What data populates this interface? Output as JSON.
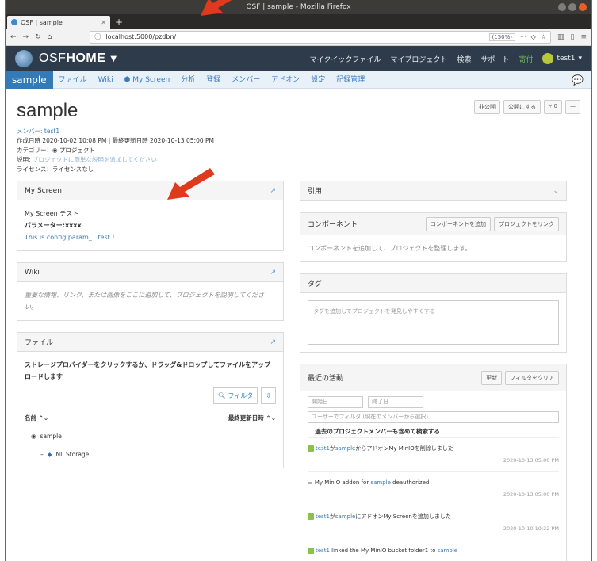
{
  "window": {
    "title": "OSF | sample - Mozilla Firefox"
  },
  "browser": {
    "tab_label": "OSF | sample",
    "url": "localhost:5000/pzdbn/",
    "zoom": "(150%)"
  },
  "osf": {
    "brand_light": "OSF",
    "brand_bold": "HOME",
    "menu": [
      "マイクイックファイル",
      "マイプロジェクト",
      "検索",
      "サポート",
      "寄付"
    ],
    "user": "test1"
  },
  "project_nav": {
    "items": [
      "sample",
      "ファイル",
      "Wiki",
      "My Screen",
      "分析",
      "登録",
      "メンバー",
      "アドオン",
      "設定",
      "記録管理"
    ]
  },
  "project": {
    "title": "sample",
    "members_label": "メンバー:",
    "members_value": "test1",
    "dates": "作成日時 2020-10-02 10:08 PM | 最終更新日時 2020-10-13 05:00 PM",
    "category": "カテゴリー：",
    "category_value": "プロジェクト",
    "description_label": "説明:",
    "description_value": "プロジェクトに簡単な説明を追加してください",
    "license": "ライセンス：ライセンスなし",
    "buttons": [
      "非公開",
      "公開にする",
      "0",
      "—"
    ]
  },
  "panels": {
    "myscreen": {
      "title": "My Screen",
      "line1": "My Screen テスト",
      "line2": "パラメーター:xxxx",
      "line3": "This is config.param_1 test !"
    },
    "wiki": {
      "title": "Wiki",
      "body": "重要な情報、リンク、または画像をここに追加して、プロジェクトを説明してください。"
    },
    "files": {
      "title": "ファイル",
      "intro": "ストレージプロバイダーをクリックするか、ドラッグ&ドロップしてファイルをアップロードします",
      "filter": "フィルタ",
      "col_name": "名前",
      "col_modified": "最終更新日時",
      "tree": [
        "sample",
        "NII Storage"
      ]
    },
    "citation": {
      "title": "引用"
    },
    "components": {
      "title": "コンポーネント",
      "add": "コンポーネントを追加",
      "link": "プロジェクトをリンク",
      "body": "コンポーネントを追加して、プロジェクトを整理します。"
    },
    "tags": {
      "title": "タグ",
      "placeholder": "タグを追加してプロジェクトを発見しやすくする"
    },
    "activity": {
      "title": "最近の活動",
      "refresh": "更新",
      "clear": "フィルタをクリア",
      "start": "開始日",
      "end": "終了日",
      "user_filter": "ユーザーでフィルタ (現在のメンバーから選択)",
      "include_past": "過去のプロジェクトメンバーも含めて検索する",
      "entries": [
        {
          "user": "test1",
          "text1": "が",
          "project": "sample",
          "text2": "からアドオンMy MinIOを削除しました",
          "when": "2020-10-13 05:00 PM"
        },
        {
          "user": "",
          "text1": "My MinIO addon for ",
          "project": "sample",
          "text2": " deauthorized",
          "when": "2020-10-13 05:00 PM"
        },
        {
          "user": "test1",
          "text1": "が",
          "project": "sample",
          "text2": "にアドオンMy Screenを追加しました",
          "when": "2020-10-10 10:22 PM"
        },
        {
          "user": "test1",
          "text1": " linked the My MinIO bucket folder1 to ",
          "project": "sample",
          "text2": "",
          "when": ""
        }
      ]
    }
  }
}
